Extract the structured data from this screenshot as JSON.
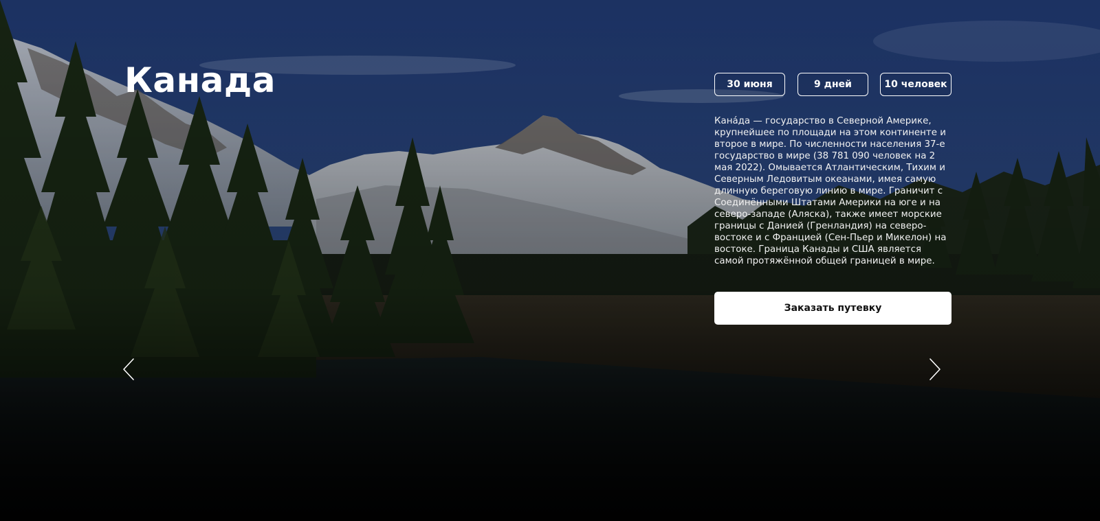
{
  "slide": {
    "title": "Канада",
    "chips": {
      "date": "30 июня",
      "duration": "9 дней",
      "people": "10 человек"
    },
    "description": "Кана́да — государство в Северной Америке, крупнейшее по площади на этом континенте и второе в мире. По численности населения 37-е государство в мире (38 781 090 человек на 2 мая 2022). Омывается Атлантическим, Тихим и Северным Ледовитым океанами, имея самую длинную береговую линию в мире. Граничит с Соединёнными Штатами Америки на юге и на северо-западе (Аляска), также имеет морские границы с Данией (Гренландия) на северо-востоке и с Францией (Сен-Пьер и Микелон) на востоке. Граница Канады и США является самой протяжённой общей границей в мире.",
    "order_button": "Заказать путевку"
  },
  "navigation": {
    "prev_icon": "chevron-left-icon",
    "next_icon": "chevron-right-icon"
  },
  "colors": {
    "text": "#ffffff",
    "button_bg": "#ffffff",
    "button_text": "#111111",
    "sky": "#2b4a8a"
  }
}
